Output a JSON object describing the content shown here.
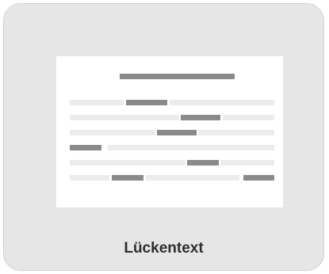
{
  "card": {
    "label": "Lückentext",
    "icon": "cloze-text-icon"
  }
}
